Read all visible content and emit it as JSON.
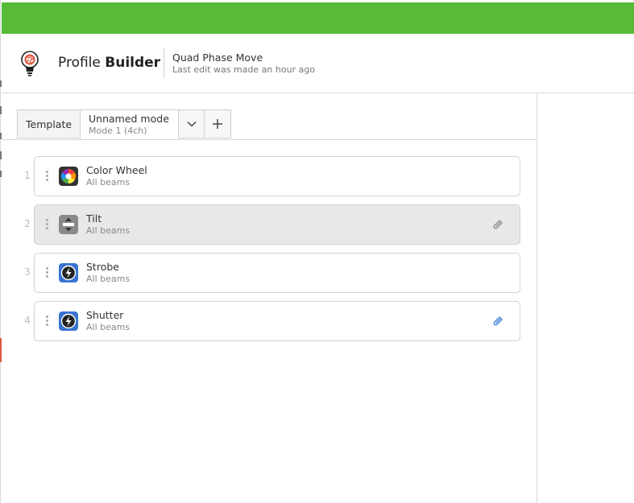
{
  "app": {
    "title_normal": "Profile",
    "title_bold": "Builder"
  },
  "profile": {
    "name": "Quad Phase Move",
    "last_edit": "Last edit was made an hour ago"
  },
  "tabs": {
    "template_label": "Template",
    "mode_name": "Unnamed mode",
    "mode_sub": "Mode 1 (4ch)"
  },
  "capabilities": [
    {
      "number": "1",
      "name": "Color Wheel",
      "scope": "All beams",
      "icon": "color-wheel-icon",
      "linked": false,
      "selected": false
    },
    {
      "number": "2",
      "name": "Tilt",
      "scope": "All beams",
      "icon": "tilt-icon",
      "linked": true,
      "selected": true
    },
    {
      "number": "3",
      "name": "Strobe",
      "scope": "All beams",
      "icon": "strobe-icon",
      "linked": false,
      "selected": false
    },
    {
      "number": "4",
      "name": "Shutter",
      "scope": "All beams",
      "icon": "shutter-icon",
      "linked": true,
      "selected": false
    }
  ],
  "colors": {
    "accent_green": "#58bb38",
    "link_blue": "#3a7fd5",
    "strobe_blue": "#3a74d0"
  }
}
